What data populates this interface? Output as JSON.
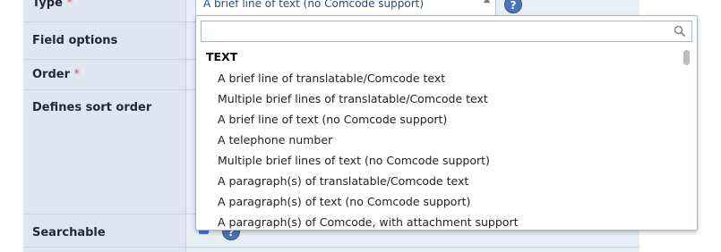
{
  "form": {
    "type_label": "Type",
    "field_options_label": "Field options",
    "order_label": "Order",
    "defines_sort_label": "Defines sort order",
    "searchable_label": "Searchable",
    "required_marker": "*",
    "type_selected": "A brief line of text (no Comcode support)",
    "help_glyph": "?"
  },
  "dropdown": {
    "search_value": "",
    "group_label": "TEXT",
    "options": [
      "A brief line of translatable/Comcode text",
      "Multiple brief lines of translatable/Comcode text",
      "A brief line of text (no Comcode support)",
      "A telephone number",
      "Multiple brief lines of text (no Comcode support)",
      "A paragraph(s) of translatable/Comcode text",
      "A paragraph(s) of text (no Comcode support)",
      "A paragraph(s) of Comcode, with attachment support"
    ]
  },
  "colors": {
    "accent": "#4a72b8",
    "label_bg": "#dfe6f1",
    "form_bg": "#e9eef6"
  },
  "icons": {
    "search": "magnifier-icon",
    "help": "help-icon",
    "select": "chevron-up-icon"
  }
}
